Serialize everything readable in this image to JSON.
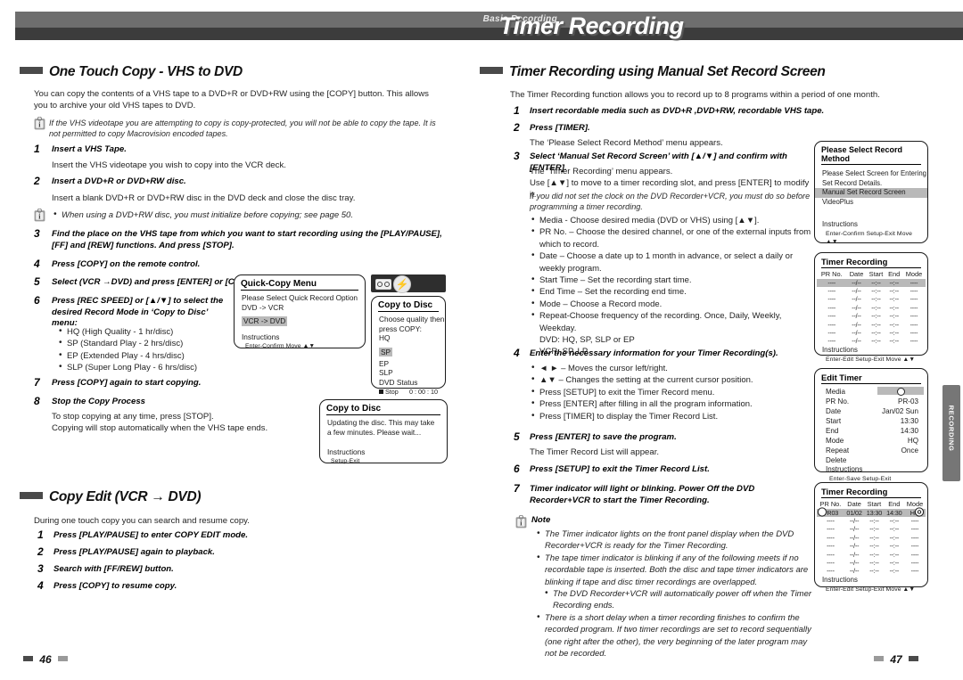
{
  "header": {
    "chapter": "Basic Recording",
    "title": "Timer Recording"
  },
  "left_page": {
    "page_number": "46",
    "section1": {
      "heading": "One Touch Copy - VHS to DVD",
      "intro": "You can copy the contents of a VHS tape to a DVD+R or DVD+RW using the [COPY] button. This allows you to archive your old VHS tapes to DVD.",
      "note": "If the VHS videotape you are attempting to copy is copy-protected, you will not be able to copy the tape. It is not permitted to copy Macrovision encoded tapes.",
      "steps": [
        {
          "n": "1",
          "title": "Insert a VHS Tape.",
          "body": "Insert the VHS videotape you wish to copy into the VCR deck."
        },
        {
          "n": "2",
          "title": "Insert a DVD+R or DVD+RW disc.",
          "body": "Insert a blank DVD+R or DVD+RW disc in the DVD deck and close the disc tray."
        },
        {
          "n": "3",
          "title": "Find the place on the VHS tape from which you want to start recording using the [PLAY/PAUSE], [FF] and [REW] functions. And press [STOP].",
          "body": ""
        },
        {
          "n": "4",
          "title": "Press [COPY] on the remote control.",
          "body": ""
        },
        {
          "n": "5",
          "title": "Select (VCR →DVD) and press [ENTER] or [COPY].",
          "body": ""
        },
        {
          "n": "6",
          "title": "Press [REC SPEED] or [▲/▼] to select the desired Record Mode in ‘Copy to Disc’ menu:",
          "body": ""
        },
        {
          "n": "7",
          "title": "Press [COPY] again to start copying.",
          "body": ""
        },
        {
          "n": "8",
          "title": "Stop the Copy Process",
          "body": "To stop copying at any time, press [STOP]."
        }
      ],
      "disc_note": "When using a DVD+RW disc, you must initialize before copying; see page 50.",
      "modes": [
        "HQ (High Quality - 1 hr/disc)",
        "SP (Standard Play - 2 hrs/disc)",
        "EP (Extended Play - 4 hrs/disc)",
        "SLP (Super Long Play - 6 hrs/disc)"
      ],
      "stop_body2": "Copying will stop automatically when the VHS tape ends."
    },
    "section2": {
      "heading": "Copy Edit (VCR → DVD)",
      "intro": "During one touch copy you can search and resume copy.",
      "steps": [
        {
          "n": "1",
          "title": "Press [PLAY/PAUSE] to enter COPY EDIT mode."
        },
        {
          "n": "2",
          "title": "Press [PLAY/PAUSE] again to playback."
        },
        {
          "n": "3",
          "title": "Search with [FF/REW] button."
        },
        {
          "n": "4",
          "title": "Press [COPY] to resume copy."
        }
      ]
    },
    "osd_quick_copy": {
      "title": "Quick-Copy Menu",
      "prompt": "Please Select Quick Record Option",
      "options": [
        "DVD -> VCR",
        "VCR -> DVD"
      ],
      "selected": "VCR -> DVD",
      "instructions_label": "Instructions",
      "instructions": "Enter-Confirm  Move ▲▼"
    },
    "osd_copy_to_disc": {
      "title": "Copy to Disc",
      "prompt_line1": "Choose quality then",
      "prompt_line2": "press COPY:",
      "options": [
        "HQ",
        "SP",
        "EP",
        "SLP",
        "DVD Status"
      ],
      "selected": "SP",
      "status_label": "Stop",
      "status_time": "0 : 00 : 10"
    },
    "osd_copy_updating": {
      "title": "Copy to Disc",
      "body": "Updating the disc. This may take a few minutes. Please wait...",
      "instructions_label": "Instructions",
      "instructions": "Setup-Exit"
    }
  },
  "right_page": {
    "page_number": "47",
    "side_tab": "RECORDING",
    "section": {
      "heading": "Timer Recording using Manual Set Record Screen",
      "intro": "The Timer Recording function allows you to record up to 8 programs within a period of one month.",
      "steps": [
        {
          "n": "1",
          "title": "Insert recordable media such as DVD+R ,DVD+RW, recordable VHS tape."
        },
        {
          "n": "2",
          "title": "Press [TIMER].",
          "body": "The ‘Please Select Record Method’ menu appears."
        },
        {
          "n": "3",
          "title": "Select ‘Manual Set Record Screen’ with [▲/▼] and confirm with [ENTER].",
          "body": "The ‘Timer Recording’ menu appears."
        },
        {
          "n": "4",
          "title": "Enter the necessary information for your Timer Recording(s)."
        },
        {
          "n": "5",
          "title": "Press [ENTER] to save the program.",
          "body": "The Timer Record List will appear."
        },
        {
          "n": "6",
          "title": "Press [SETUP] to exit the Timer Record List."
        },
        {
          "n": "7",
          "title": "Timer indicator will light or blinking. Power Off the DVD Recorder+VCR to start the Timer Recording."
        }
      ],
      "step3_use": "Use [▲▼] to move to a timer recording slot, and press [ENTER] to modify it.",
      "step3_italic": "If you did not set the clock on the DVD Recorder+VCR, you must do so before programming a timer recording.",
      "step3_bullets": [
        "Media - Choose desired media (DVD or VHS) using [▲▼].",
        "PR No. – Choose the desired channel, or one of the external inputs from which to record.",
        "Date – Choose a date up to 1 month in advance, or select a daily or weekly program.",
        "Start Time – Set the recording start time.",
        "End Time – Set the recording end time.",
        "Mode – Choose a Record mode.",
        "Repeat-Choose frequency of the recording. Once, Daily, Weekly, Weekday."
      ],
      "mode_lines": [
        "DVD: HQ, SP, SLP or EP",
        "VCR: SP, LP"
      ],
      "step4_bullets": [
        "◄ ► – Moves the cursor left/right.",
        "▲▼ – Changes the setting at the current cursor position.",
        "Press [SETUP] to exit the Timer Record menu.",
        "Press [ENTER] after filling in all the program information.",
        "Press [TIMER] to display the Timer Record List."
      ]
    },
    "note": {
      "label": "Note",
      "items": [
        "The Timer indicator lights on the front panel display when the DVD Recorder+VCR is ready for the Timer Recording.",
        "The tape timer indicator is blinking if any of the following meets if no recordable tape is inserted. Both the disc and tape timer indicators are blinking if tape and disc timer recordings are overlapped.",
        "The DVD Recorder+VCR will automatically power off when the Timer Recording ends.",
        "There is a short delay when a timer recording finishes to confirm the recorded program. If two timer recordings are set to record sequentially (one right after the other), the very beginning of the later program may not be recorded."
      ]
    },
    "osd_record_method": {
      "title": "Please Select Record Method",
      "prompt_line1": "Please Select Screen for Entering",
      "prompt_line2": "Set Record Details.",
      "options": [
        "Manual Set Record Screen",
        "VideoPlus"
      ],
      "selected": "Manual Set Record Screen",
      "instructions_label": "Instructions",
      "instructions": "Enter-Confirm  Setup-Exit  Move ▲▼"
    },
    "osd_timer_recording_empty": {
      "title": "Timer Recording",
      "columns": [
        "PR No.",
        "Date",
        "Start",
        "End",
        "Mode"
      ],
      "rows": [
        [
          "----",
          "--/--",
          "--:--",
          "--:--",
          "----"
        ],
        [
          "----",
          "--/--",
          "--:--",
          "--:--",
          "----"
        ],
        [
          "----",
          "--/--",
          "--:--",
          "--:--",
          "----"
        ],
        [
          "----",
          "--/--",
          "--:--",
          "--:--",
          "----"
        ],
        [
          "----",
          "--/--",
          "--:--",
          "--:--",
          "----"
        ],
        [
          "----",
          "--/--",
          "--:--",
          "--:--",
          "----"
        ],
        [
          "----",
          "--/--",
          "--:--",
          "--:--",
          "----"
        ],
        [
          "----",
          "--/--",
          "--:--",
          "--:--",
          "----"
        ]
      ],
      "selected_row": 0,
      "instructions_label": "Instructions",
      "instructions": "Enter-Edit  Setup-Exit  Move ▲▼"
    },
    "osd_edit_timer": {
      "title": "Edit Timer",
      "fields": [
        {
          "label": "Media",
          "value": ""
        },
        {
          "label": "PR No.",
          "value": "PR-03"
        },
        {
          "label": "Date",
          "value": "Jan/02 Sun"
        },
        {
          "label": "Start",
          "value": "13:30"
        },
        {
          "label": "End",
          "value": "14:30"
        },
        {
          "label": "Mode",
          "value": "HQ"
        },
        {
          "label": "Repeat",
          "value": "Once"
        },
        {
          "label": "Delete",
          "value": ""
        }
      ],
      "instructions_label": "Instructions",
      "instructions": "Enter-Save  Setup-Exit"
    },
    "osd_timer_recording_filled": {
      "title": "Timer Recording",
      "columns": [
        "PR No.",
        "Date",
        "Start",
        "End",
        "Mode"
      ],
      "rows": [
        [
          "PR03",
          "01/02",
          "13:30",
          "14:30",
          "HQ"
        ],
        [
          "----",
          "--/--",
          "--:--",
          "--:--",
          "----"
        ],
        [
          "----",
          "--/--",
          "--:--",
          "--:--",
          "----"
        ],
        [
          "----",
          "--/--",
          "--:--",
          "--:--",
          "----"
        ],
        [
          "----",
          "--/--",
          "--:--",
          "--:--",
          "----"
        ],
        [
          "----",
          "--/--",
          "--:--",
          "--:--",
          "----"
        ],
        [
          "----",
          "--/--",
          "--:--",
          "--:--",
          "----"
        ],
        [
          "----",
          "--/--",
          "--:--",
          "--:--",
          "----"
        ]
      ],
      "selected_row": 0,
      "instructions_label": "Instructions",
      "instructions": "Enter-Edit  Setup-Exit  Move ▲▼"
    }
  }
}
